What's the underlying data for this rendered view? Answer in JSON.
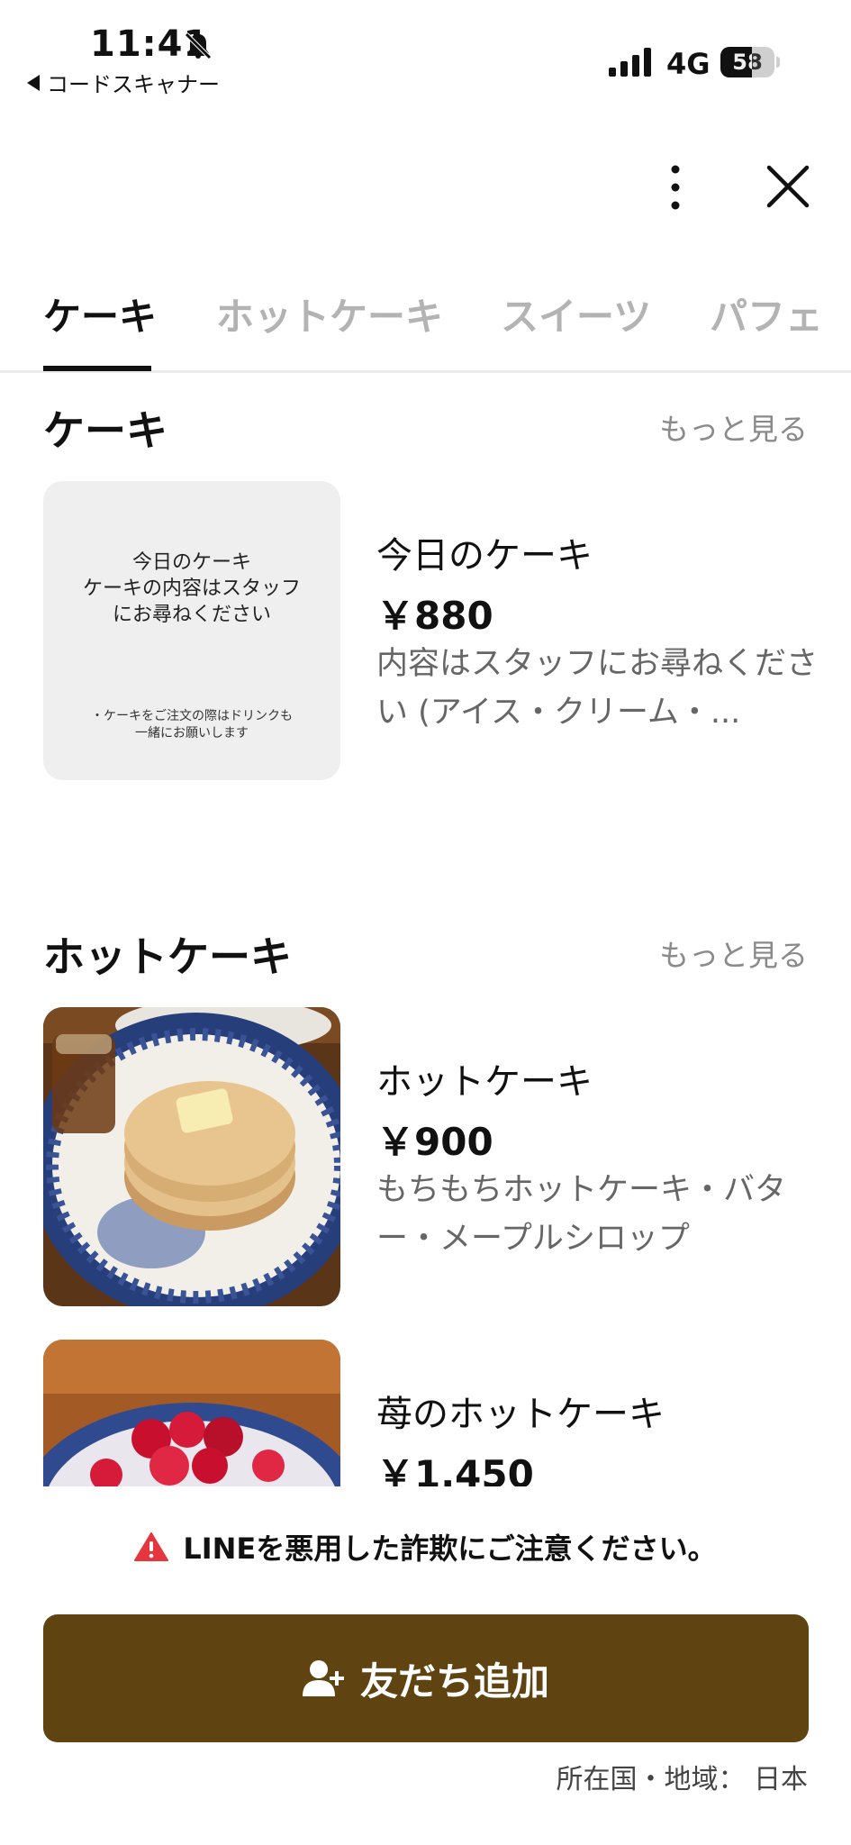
{
  "status_bar": {
    "time": "11:41",
    "back_app": "コードスキャナー",
    "network": "4G",
    "battery": 58,
    "battery_label": "58"
  },
  "icons": {
    "bell": "bell-slash-icon",
    "signal": "signal-icon",
    "more": "more-vertical-icon",
    "close": "close-icon",
    "warning": "warning-icon",
    "add_user": "add-user-icon"
  },
  "tabs": [
    {
      "label": "ケーキ",
      "active": true
    },
    {
      "label": "ホットケーキ",
      "active": false
    },
    {
      "label": "スイーツ",
      "active": false
    },
    {
      "label": "パフェ",
      "active": false
    }
  ],
  "sections": [
    {
      "title": "ケーキ",
      "see_more": "もっと見る",
      "items": [
        {
          "name": "今日のケーキ",
          "price": "￥880",
          "desc": "内容はスタッフにお尋ねくださ い (アイス・クリーム・...",
          "image_text_main": "今日のケーキ\nケーキの内容はスタッフ\nにお尋ねください",
          "image_text_note": "・ケーキをご注文の際はドリンクも\n一緒にお願いします"
        }
      ]
    },
    {
      "title": "ホットケーキ",
      "see_more": "もっと見る",
      "items": [
        {
          "name": "ホットケーキ",
          "price": "￥900",
          "desc": "もちもちホットケーキ・バター・メープルシロップ"
        },
        {
          "name": "苺のホットケーキ",
          "price": "￥1,450"
        }
      ]
    }
  ],
  "footer": {
    "warning": "LINEを悪用した詐欺にご注意ください。",
    "add_friend": "友だち追加",
    "country": "所在国・地域： 日本"
  },
  "colors": {
    "button_bg": "#5f4411",
    "warning_red": "#e5363f",
    "muted_text": "#8a8a8a"
  }
}
